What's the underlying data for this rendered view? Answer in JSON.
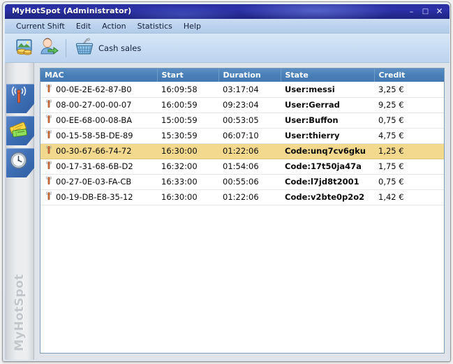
{
  "window": {
    "title": "MyHotSpot  (Administrator)",
    "controls": {
      "minimize": "–",
      "maximize": "□",
      "close": "✕"
    },
    "accent_titlebar": "#2b31a8",
    "accent_header": "#4a80b8",
    "accent_selected_row": "#f2d98e"
  },
  "menubar": {
    "items": [
      {
        "label": "Current Shift",
        "name": "menu-current-shift"
      },
      {
        "label": "Edit",
        "name": "menu-edit"
      },
      {
        "label": "Action",
        "name": "menu-action"
      },
      {
        "label": "Statistics",
        "name": "menu-statistics"
      },
      {
        "label": "Help",
        "name": "menu-help"
      }
    ]
  },
  "toolbar": {
    "buttons": [
      {
        "icon": "money-card-icon",
        "label": ""
      },
      {
        "icon": "user-account-icon",
        "label": ""
      }
    ],
    "cash_sales": {
      "icon": "shopping-basket-icon",
      "label": "Cash sales"
    }
  },
  "sidebar": {
    "brand": "MyHotSpot",
    "items": [
      {
        "icon": "hotspot-antenna-icon",
        "name": "sidebar-item-hotspot"
      },
      {
        "icon": "tickets-voucher-icon",
        "name": "sidebar-item-tickets"
      },
      {
        "icon": "clock-history-icon",
        "name": "sidebar-item-history"
      }
    ]
  },
  "table": {
    "columns": [
      {
        "key": "mac",
        "label": "MAC"
      },
      {
        "key": "start",
        "label": "Start"
      },
      {
        "key": "duration",
        "label": "Duration"
      },
      {
        "key": "state",
        "label": "State"
      },
      {
        "key": "credit",
        "label": "Credit"
      }
    ],
    "rows": [
      {
        "mac": "00-0E-2E-62-87-B0",
        "start": "16:09:58",
        "duration": "03:17:04",
        "state": "User:messi",
        "credit": "3,25 €",
        "selected": false,
        "signal": "wifi-signal-icon"
      },
      {
        "mac": "08-00-27-00-00-07",
        "start": "16:00:59",
        "duration": "09:23:04",
        "state": "User:Gerrad",
        "credit": "9,25 €",
        "selected": false,
        "signal": "wifi-signal-icon"
      },
      {
        "mac": "00-EE-68-00-08-BA",
        "start": "15:00:59",
        "duration": "00:53:05",
        "state": "User:Buffon",
        "credit": "0,75 €",
        "selected": false,
        "signal": "wifi-signal-icon"
      },
      {
        "mac": "00-15-58-5B-DE-89",
        "start": "15:30:59",
        "duration": "06:07:10",
        "state": "User:thierry",
        "credit": "4,75 €",
        "selected": false,
        "signal": "wifi-signal-icon"
      },
      {
        "mac": "00-30-67-66-74-72",
        "start": "16:30:00",
        "duration": "01:22:06",
        "state": "Code:unq7cv6gku",
        "credit": "1,25 €",
        "selected": true,
        "signal": "wifi-signal-icon"
      },
      {
        "mac": "00-17-31-68-6B-D2",
        "start": "16:32:00",
        "duration": "01:54:06",
        "state": "Code:17t50ja47a",
        "credit": "1,75 €",
        "selected": false,
        "signal": "wifi-signal-icon"
      },
      {
        "mac": "00-27-0E-03-FA-CB",
        "start": "16:33:00",
        "duration": "00:55:06",
        "state": "Code:l7jd8t2001",
        "credit": "0,75 €",
        "selected": false,
        "signal": "wifi-signal-icon"
      },
      {
        "mac": "00-19-DB-E8-35-12",
        "start": "16:30:00",
        "duration": "01:22:06",
        "state": "Code:v2bte0p2o2",
        "credit": "1,42 €",
        "selected": false,
        "signal": "wifi-signal-icon"
      }
    ]
  }
}
